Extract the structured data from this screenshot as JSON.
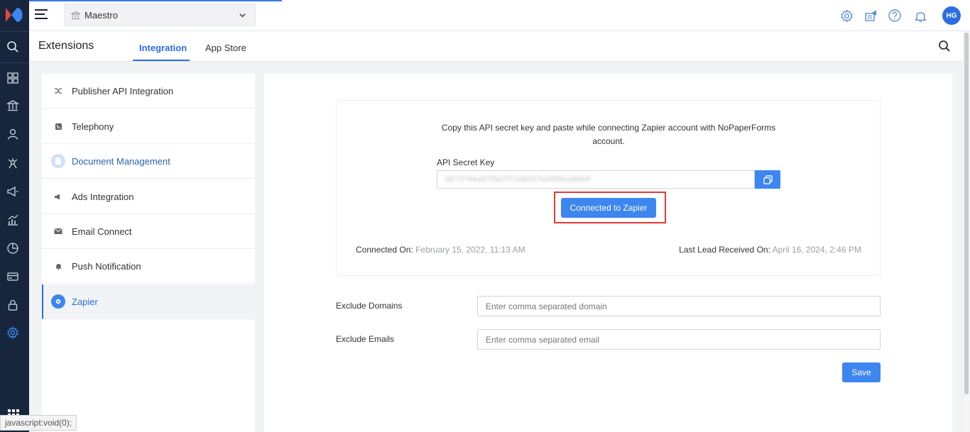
{
  "topbar": {
    "institute": "Maestro",
    "avatar_initials": "HG",
    "icons": [
      "gear-icon",
      "announcement-icon",
      "help-icon",
      "bell-icon"
    ]
  },
  "subheader": {
    "title": "Extensions",
    "tabs": [
      {
        "label": "Integration",
        "active": true
      },
      {
        "label": "App Store",
        "active": false
      }
    ]
  },
  "menu": {
    "items": [
      {
        "label": "Publisher API Integration",
        "icon": "shuffle-icon"
      },
      {
        "label": "Telephony",
        "icon": "phone-icon"
      },
      {
        "label": "Document Management",
        "icon": "document-icon"
      },
      {
        "label": "Ads Integration",
        "icon": "megaphone-icon"
      },
      {
        "label": "Email Connect",
        "icon": "envelope-icon"
      },
      {
        "label": "Push Notification",
        "icon": "bell-icon"
      },
      {
        "label": "Zapier",
        "icon": "gear-icon",
        "active": true
      }
    ]
  },
  "zapier": {
    "description": "Copy this API secret key and paste while connecting Zapier account with NoPaperForms account.",
    "key_label": "API Secret Key",
    "key_value": "887276ea97f3e7f7108427e0955ca90e9",
    "connect_button": "Connected to Zapier",
    "connected_on_label": "Connected On:",
    "connected_on_value": "February 15, 2022, 11:13 AM",
    "last_lead_label": "Last Lead Received On:",
    "last_lead_value": "April 16, 2024, 2:46 PM"
  },
  "form": {
    "exclude_domains_label": "Exclude Domains",
    "exclude_domains_placeholder": "Enter comma separated domain",
    "exclude_emails_label": "Exclude Emails",
    "exclude_emails_placeholder": "Enter comma separated email",
    "save_label": "Save"
  },
  "statusbar": "javascript:void(0);",
  "colors": {
    "accent": "#3d86f0",
    "rail": "#18263d",
    "highlight_border": "#e53935"
  }
}
